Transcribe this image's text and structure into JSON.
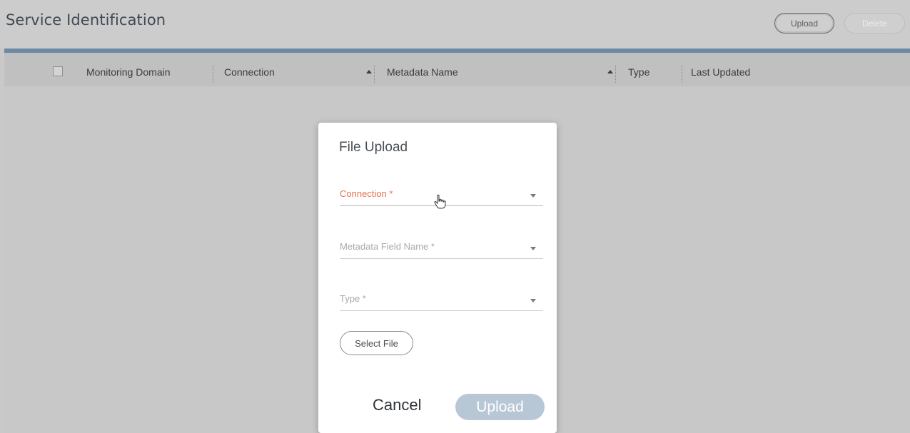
{
  "header": {
    "title": "Service Identification",
    "upload_label": "Upload",
    "delete_label": "Delete"
  },
  "table": {
    "columns": [
      {
        "label": "Monitoring Domain",
        "sort": ""
      },
      {
        "label": "Connection",
        "sort": "ascending"
      },
      {
        "label": "Metadata Name",
        "sort": "ascending"
      },
      {
        "label": "Type",
        "sort": ""
      },
      {
        "label": "Last Updated",
        "sort": ""
      }
    ]
  },
  "dialog": {
    "title": "File Upload",
    "fields": [
      {
        "label": "Connection *",
        "state": "active"
      },
      {
        "label": "Metadata Field Name *",
        "state": "idle"
      },
      {
        "label": "Type *",
        "state": "idle"
      }
    ],
    "select_file_label": "Select File",
    "cancel_label": "Cancel",
    "upload_label": "Upload"
  },
  "colors": {
    "accent_bar": "#6d8aa3",
    "required_active_label": "#e8704d",
    "upload_disabled": "#b7c7d6"
  },
  "icons": {
    "dropdown": "caret-down-icon",
    "sort": "sort-asc-icon",
    "cursor": "hand-pointer-icon"
  }
}
